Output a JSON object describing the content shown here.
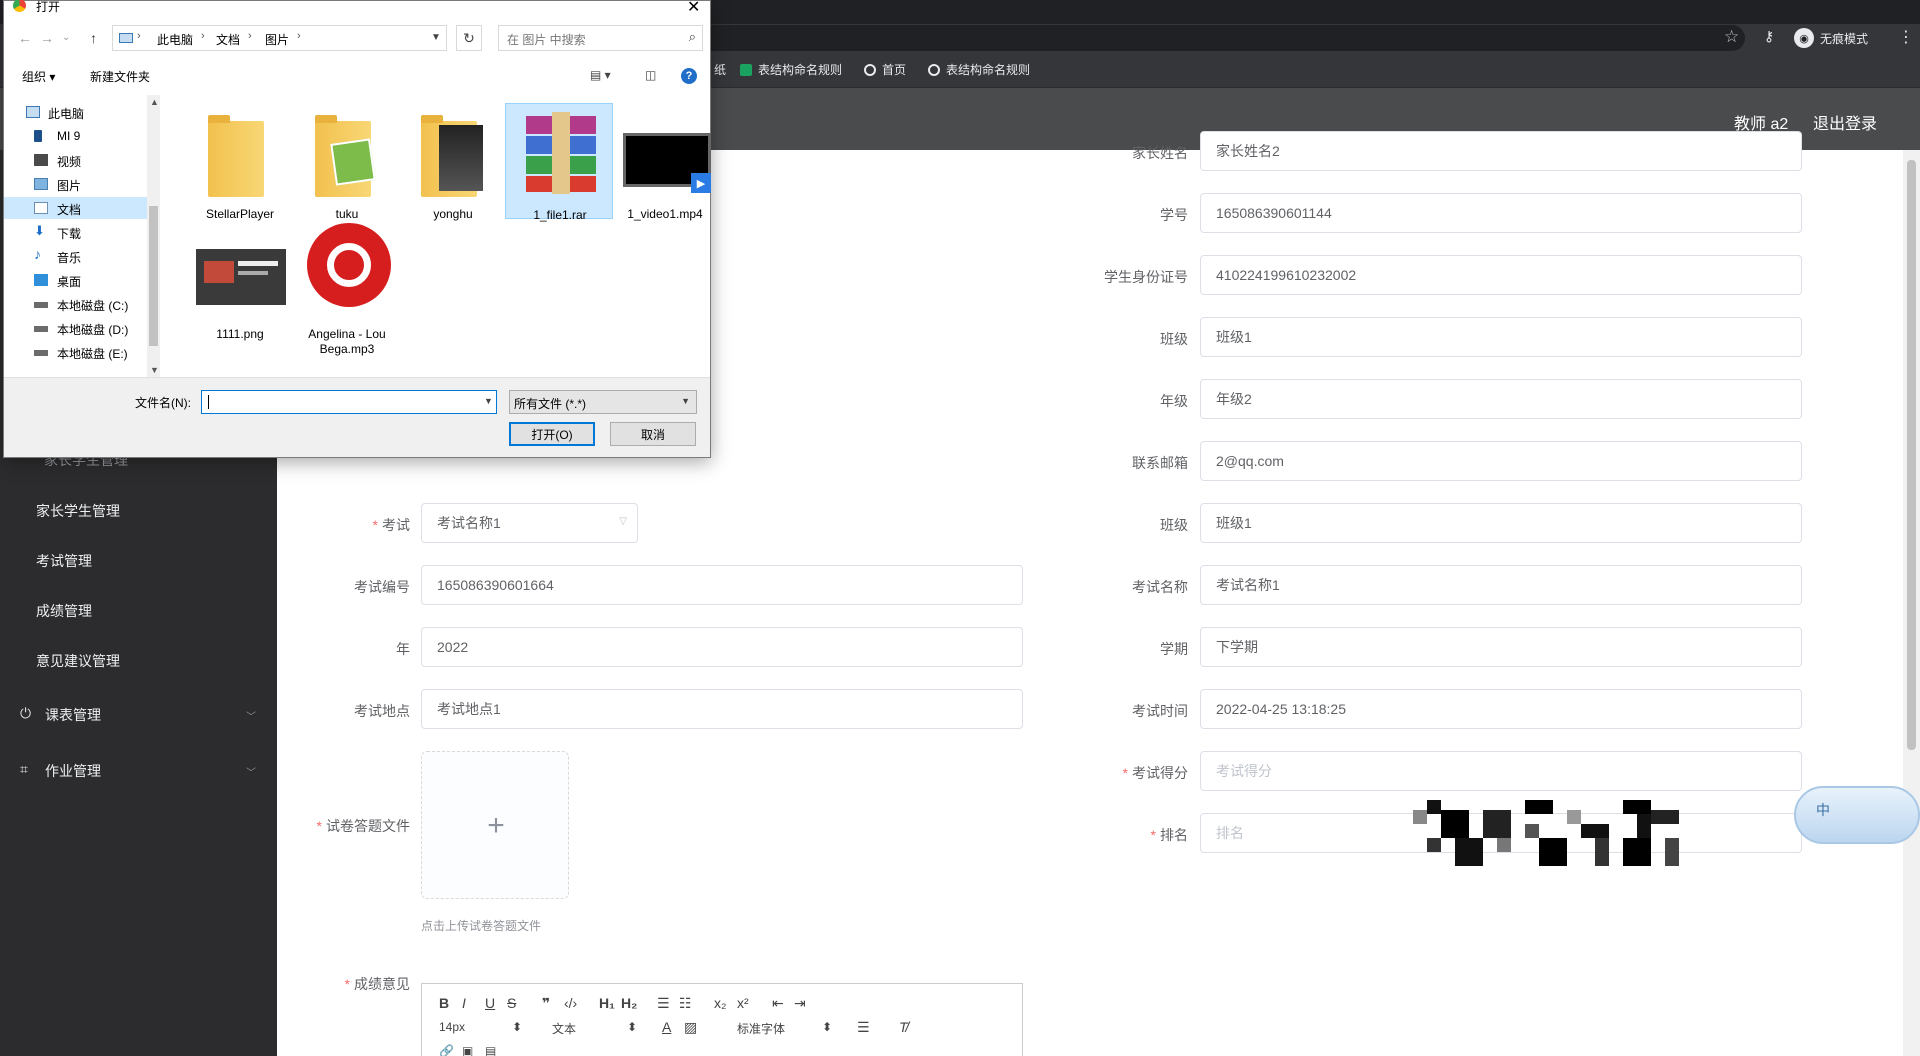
{
  "browser": {
    "incognito_label": "无痕模式",
    "bookmarks": [
      "纸",
      "表结构命名规则",
      "首页",
      "表结构命名规则"
    ]
  },
  "header": {
    "user": "教师 a2",
    "logout": "退出登录"
  },
  "sidebar": {
    "partial_item": "家长学生管理",
    "items": [
      "家长学生管理",
      "考试管理",
      "成绩管理",
      "意见建议管理"
    ],
    "groups": [
      "课表管理",
      "作业管理"
    ]
  },
  "form": {
    "left": {
      "exam": {
        "label": "考试",
        "value": "考试名称1"
      },
      "exam_no": {
        "label": "考试编号",
        "value": "165086390601664"
      },
      "year": {
        "label": "年",
        "value": "2022"
      },
      "exam_place": {
        "label": "考试地点",
        "value": "考试地点1"
      },
      "paper_file": {
        "label": "试卷答题文件",
        "hint": "点击上传试卷答题文件"
      },
      "opinion": {
        "label": "成绩意见"
      }
    },
    "right": {
      "parent_name": {
        "label": "家长姓名",
        "value": "家长姓名2"
      },
      "student_no": {
        "label": "学号",
        "value": "165086390601144"
      },
      "id_card": {
        "label": "学生身份证号",
        "value": "410224199610232002"
      },
      "class1": {
        "label": "班级",
        "value": "班级1"
      },
      "grade": {
        "label": "年级",
        "value": "年级2"
      },
      "email": {
        "label": "联系邮箱",
        "value": "2@qq.com"
      },
      "class2": {
        "label": "班级",
        "value": "班级1"
      },
      "exam_name": {
        "label": "考试名称",
        "value": "考试名称1"
      },
      "term": {
        "label": "学期",
        "value": "下学期"
      },
      "exam_time": {
        "label": "考试时间",
        "value": "2022-04-25 13:18:25"
      },
      "score": {
        "label": "考试得分",
        "placeholder": "考试得分"
      },
      "rank": {
        "label": "排名",
        "placeholder": "排名"
      }
    }
  },
  "editor": {
    "font_size": "14px",
    "text_type": "文本",
    "font_family": "标准字体"
  },
  "ime": {
    "label": "中"
  },
  "dialog": {
    "title": "打开",
    "breadcrumb": [
      "此电脑",
      "文档",
      "图片"
    ],
    "search_placeholder": "在 图片 中搜索",
    "organize": "组织 ▾",
    "new_folder": "新建文件夹",
    "tree": [
      "此电脑",
      "MI 9",
      "视频",
      "图片",
      "文档",
      "下载",
      "音乐",
      "桌面",
      "本地磁盘 (C:)",
      "本地磁盘 (D:)",
      "本地磁盘 (E:)"
    ],
    "files": [
      "StellarPlayer",
      "tuku",
      "yonghu",
      "1_file1.rar",
      "1_video1.mp4",
      "1111.png",
      "Angelina - Lou Bega.mp3"
    ],
    "filename_label": "文件名(N):",
    "filetype": "所有文件 (*.*)",
    "open": "打开(O)",
    "cancel": "取消"
  }
}
